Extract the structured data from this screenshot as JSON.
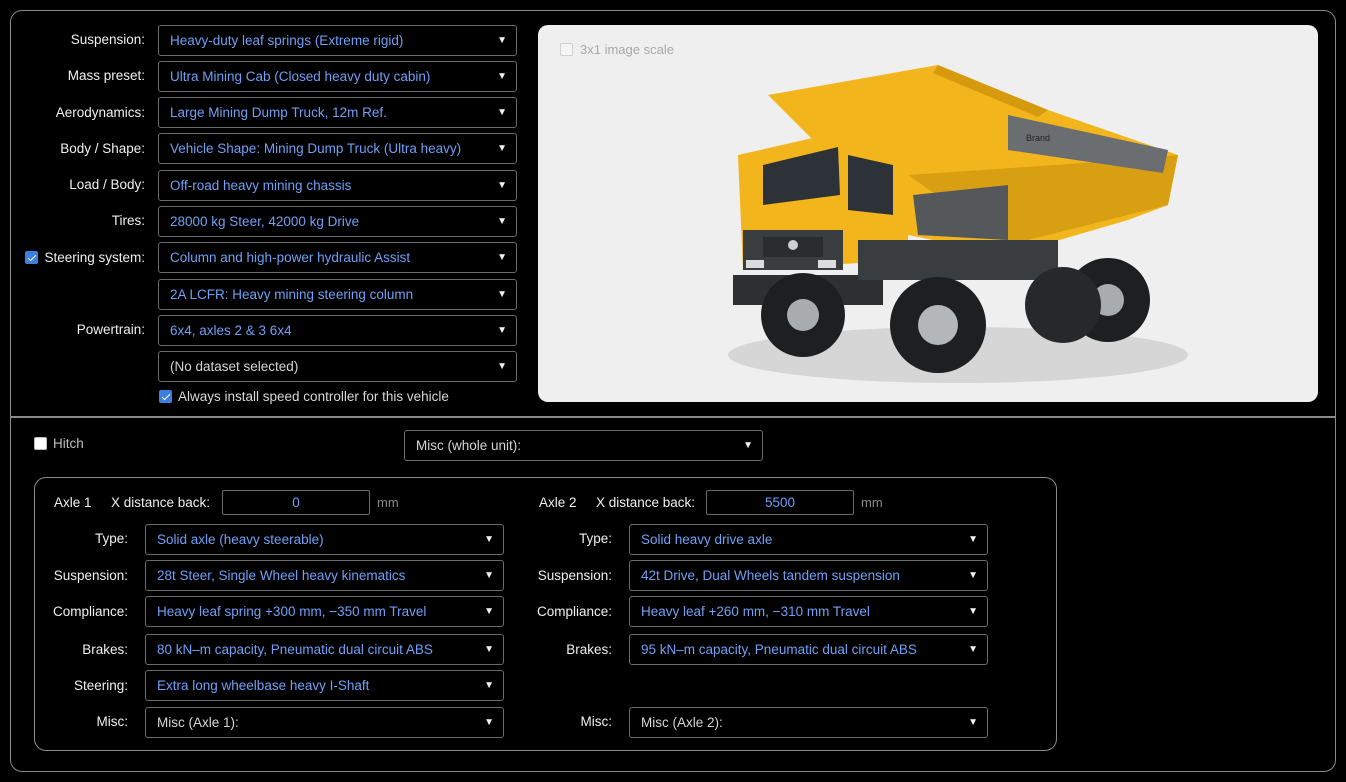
{
  "vehicle": {
    "suspension": {
      "label": "Suspension:",
      "value": "Heavy-duty leaf springs (Extreme rigid)"
    },
    "mass_preset": {
      "label": "Mass preset:",
      "value": "Ultra Mining Cab (Closed heavy duty cabin)"
    },
    "aerodynamics": {
      "label": "Aerodynamics:",
      "value": "Large Mining Dump Truck, 12m Ref."
    },
    "body_shape": {
      "label": "Body / Shape:",
      "value": "Vehicle Shape: Mining Dump Truck (Ultra heavy)"
    },
    "load_body": {
      "label": "Load / Body:",
      "value": "Off-road heavy mining chassis"
    },
    "tires": {
      "label": "Tires:",
      "value": "28000 kg Steer, 42000 kg Drive"
    },
    "steering_system": {
      "label": "Steering system:",
      "checked": true,
      "value": "Column and high-power hydraulic Assist",
      "value2": "2A LCFR: Heavy mining steering column"
    },
    "powertrain": {
      "label": "Powertrain:",
      "value": "6x4, axles 2 & 3 6x4",
      "dataset": "(No dataset selected)"
    },
    "speed_controller": {
      "label": "Always install speed controller for this vehicle",
      "checked": true
    }
  },
  "preview": {
    "scale_label": "3x1 image scale",
    "scale_checked": false,
    "truck_brand_text": "Brand"
  },
  "hitch": {
    "label": "Hitch",
    "checked": false,
    "misc_value": "Misc (whole unit):"
  },
  "axles": [
    {
      "title": "Axle 1",
      "x_label": "X distance back:",
      "x_value": "0",
      "unit": "mm",
      "type": {
        "label": "Type:",
        "value": "Solid axle (heavy steerable)"
      },
      "suspension": {
        "label": "Suspension:",
        "value": "28t Steer, Single Wheel heavy kinematics"
      },
      "compliance": {
        "label": "Compliance:",
        "value": "Heavy leaf spring +300 mm, −350 mm Travel"
      },
      "brakes": {
        "label": "Brakes:",
        "value": "80 kN–m capacity, Pneumatic dual circuit ABS"
      },
      "steering": {
        "label": "Steering:",
        "value": "Extra long wheelbase heavy I-Shaft"
      },
      "misc": {
        "label": "Misc:",
        "value": "Misc (Axle 1):"
      }
    },
    {
      "title": "Axle 2",
      "x_label": "X distance back:",
      "x_value": "5500",
      "unit": "mm",
      "type": {
        "label": "Type:",
        "value": "Solid heavy drive axle"
      },
      "suspension": {
        "label": "Suspension:",
        "value": "42t Drive, Dual Wheels tandem suspension"
      },
      "compliance": {
        "label": "Compliance:",
        "value": "Heavy leaf +260 mm, −310 mm Travel"
      },
      "brakes": {
        "label": "Brakes:",
        "value": "95 kN–m capacity, Pneumatic dual circuit ABS"
      },
      "misc": {
        "label": "Misc:",
        "value": "Misc (Axle 2):"
      }
    }
  ],
  "colors": {
    "accent": "#3d7fe0",
    "value_text": "#6fa0f5",
    "truck_yellow": "#f2b51c",
    "truck_gray": "#55585b"
  }
}
